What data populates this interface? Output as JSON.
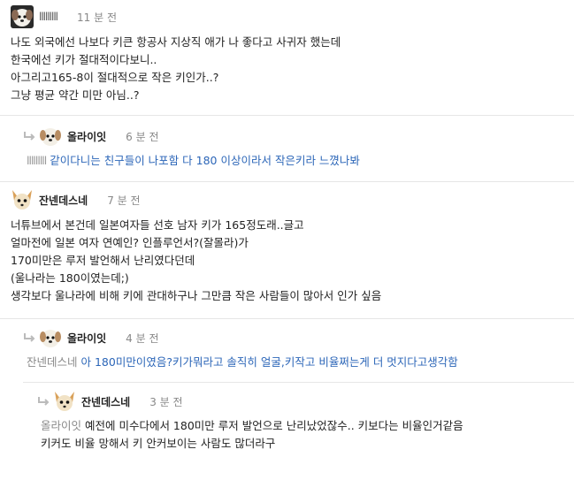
{
  "comments": [
    {
      "nick": "lllllllll",
      "time": "11 분 전",
      "lines": [
        "나도 외국에선 나보다 키큰 항공사 지상직 애가 나 좋다고 사귀자 했는데",
        "한국에선 키가 절대적이다보니..",
        "아그리고165-8이 절대적으로 작은 키인가..?",
        "그냥 평균 약간 미만 아님..?"
      ]
    },
    {
      "nick": "올라이잇",
      "time": "6 분 전",
      "mention": "lllllllll",
      "text": " 같이다니는 친구들이 나포함 다 180 이상이라서 작은키라 느꼈나봐"
    },
    {
      "nick": "잔넨데스네",
      "time": "7 분 전",
      "lines": [
        "너튜브에서 본건데 일본여자들 선호 남자 키가 165정도래..글고",
        "얼마전에 일본 여자 연예인? 인플루언서?(잘몰라)가",
        "170미만은 루저 발언해서 난리였다던데",
        "(울나라는 180이였는데;)",
        "생각보다 울나라에 비해 키에 관대하구나 그만큼 작은 사람들이 많아서 인가 싶음"
      ]
    },
    {
      "nick": "올라이잇",
      "time": "4 분 전",
      "mention": "잔넨데스네",
      "text": " 아 180미만이였음?키가뭐라고 솔직히 얼굴,키작고 비율쩌는게 더 멋지다고생각함"
    },
    {
      "nick": "잔넨데스네",
      "time": "3 분 전",
      "mention": "올라이잇",
      "lines": [
        " 예전에 미수다에서 180미만 루저 발언으로 난리났었잖수.. 키보다는 비율인거같음",
        "키커도 비율 망해서 키 안커보이는 사람도 많더라구"
      ]
    }
  ],
  "colors": {
    "reply_text": "#2c66b8",
    "meta": "#888888",
    "divider": "#e6e6e6"
  },
  "icons": [
    "reply-arrow-icon",
    "dog-avatar-icon",
    "fox-avatar-icon"
  ]
}
